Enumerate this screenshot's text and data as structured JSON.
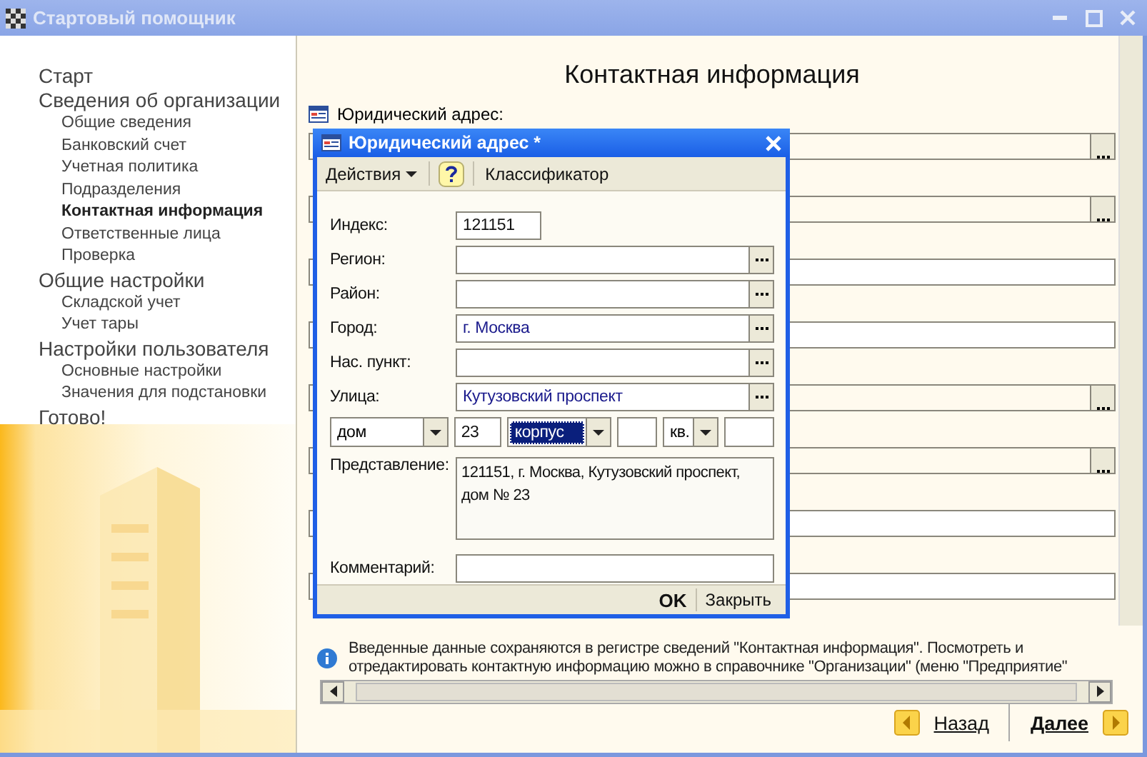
{
  "window": {
    "title": "Стартовый помощник"
  },
  "sidebar": {
    "items": [
      {
        "label": "Старт",
        "selected": false
      },
      {
        "label": "Сведения об организации",
        "selected": false,
        "children": [
          {
            "label": "Общие сведения",
            "selected": false
          },
          {
            "label": "Банковский счет",
            "selected": false
          },
          {
            "label": "Учетная политика",
            "selected": false
          },
          {
            "label": "Подразделения",
            "selected": false
          },
          {
            "label": "Контактная информация",
            "selected": true
          },
          {
            "label": "Ответственные лица",
            "selected": false
          },
          {
            "label": "Проверка",
            "selected": false
          }
        ]
      },
      {
        "label": "Общие настройки",
        "selected": false,
        "children": [
          {
            "label": "Складской учет",
            "selected": false
          },
          {
            "label": "Учет тары",
            "selected": false
          }
        ]
      },
      {
        "label": "Настройки пользователя",
        "selected": false,
        "children": [
          {
            "label": "Основные настройки",
            "selected": false
          },
          {
            "label": "Значения для подстановки",
            "selected": false
          }
        ]
      },
      {
        "label": "Готово!",
        "selected": false
      }
    ]
  },
  "page": {
    "title": "Контактная информация",
    "first_label": "Юридический адрес:",
    "fields": [
      {
        "kind": "choice"
      },
      {
        "kind": "choice"
      },
      {
        "kind": "text"
      },
      {
        "kind": "text"
      },
      {
        "kind": "choice"
      },
      {
        "kind": "choice"
      },
      {
        "kind": "text"
      },
      {
        "kind": "text"
      }
    ],
    "info": "Введенные данные сохраняются в регистре сведений \"Контактная информация\". Посмотреть и отредактировать контактную информацию можно в справочнике \"Организации\" (меню \"Предприятие\""
  },
  "dialog": {
    "title": "Юридический адрес *",
    "toolbar": {
      "actions": "Действия",
      "classifier": "Классификатор"
    },
    "fields": [
      {
        "label": "Индекс:",
        "kind": "short",
        "value": "121151"
      },
      {
        "label": "Регион:",
        "kind": "choice"
      },
      {
        "label": "Район:",
        "kind": "choice"
      },
      {
        "label": "Город:",
        "kind": "choice",
        "value": "г. Москва"
      },
      {
        "label": "Нас. пункт:",
        "kind": "choice"
      },
      {
        "label": "Улица:",
        "kind": "choice",
        "value": "Кутузовский проспект"
      }
    ],
    "house_row": [
      {
        "kind": "select",
        "value": "дом",
        "selected": false
      },
      {
        "kind": "text",
        "value": "23"
      },
      {
        "kind": "select",
        "value": "корпус",
        "selected": true
      },
      {
        "kind": "text"
      },
      {
        "kind": "select",
        "value": "кв.",
        "selected": false
      },
      {
        "kind": "text"
      }
    ],
    "presentation": {
      "label": "Представление:",
      "value": "121151, г. Москва, Кутузовский проспект, дом № 23"
    },
    "comment": {
      "label": "Комментарий:"
    },
    "buttons": {
      "ok": "OK",
      "close": "Закрыть"
    }
  },
  "nav": {
    "back": "Назад",
    "next": "Далее"
  }
}
